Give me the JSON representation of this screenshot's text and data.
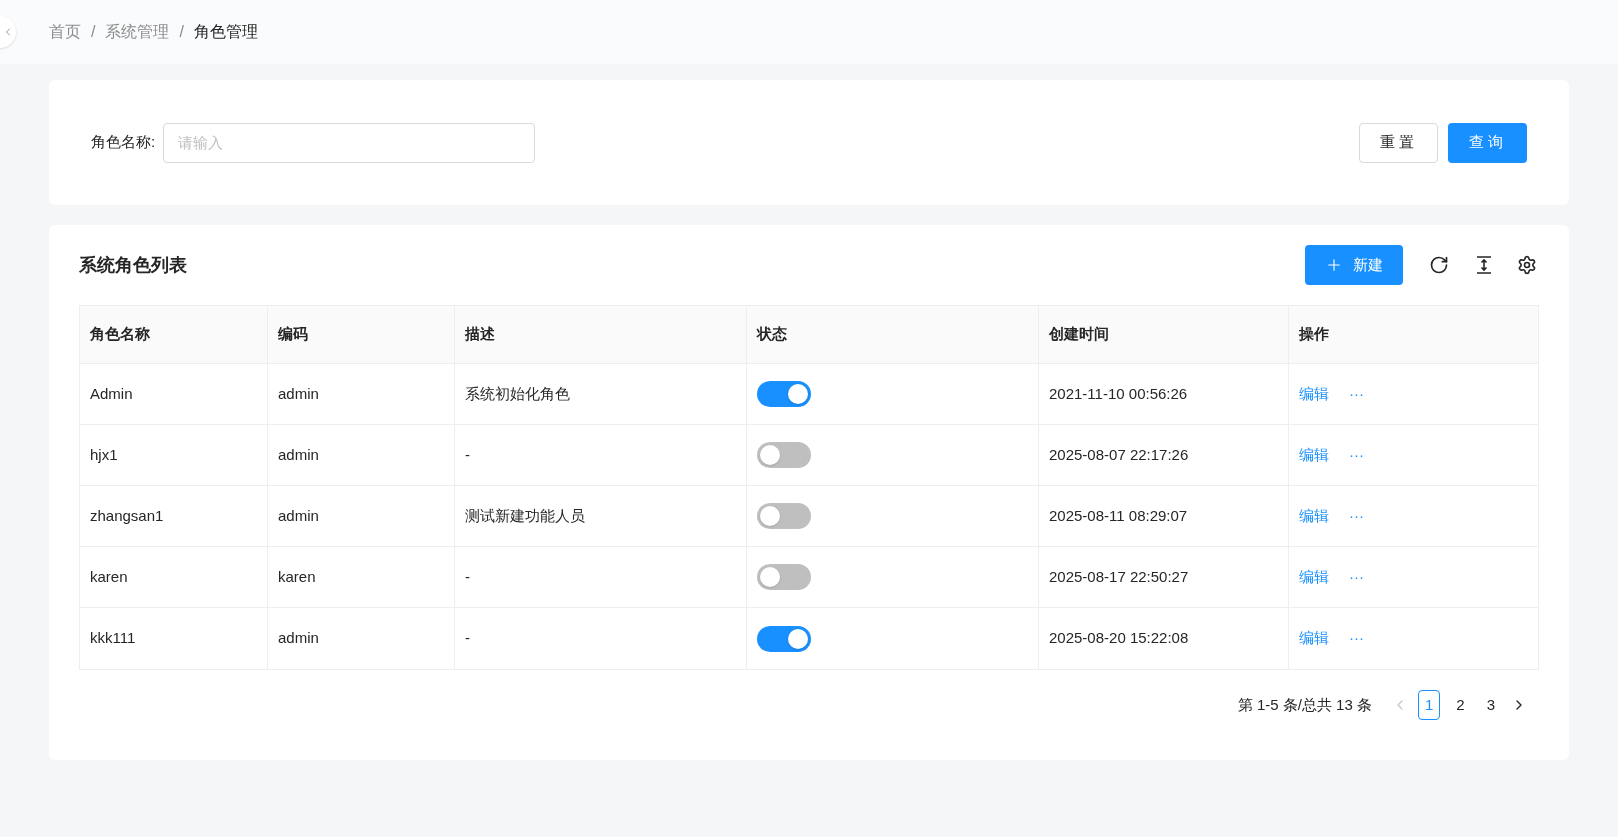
{
  "breadcrumb_separator": "/",
  "breadcrumb": [
    {
      "label": "首页",
      "current": false
    },
    {
      "label": "系统管理",
      "current": false
    },
    {
      "label": "角色管理",
      "current": true
    }
  ],
  "search": {
    "label": "角色名称:",
    "placeholder": "请输入",
    "buttons": [
      {
        "label": "重置",
        "kind": "default"
      },
      {
        "label": "查询",
        "kind": "primary"
      }
    ]
  },
  "table_card": {
    "title": "系统角色列表",
    "new_button": "新建"
  },
  "table": {
    "columns": [
      "角色名称",
      "编码",
      "描述",
      "状态",
      "创建时间",
      "操作"
    ],
    "rows": [
      {
        "name": "Admin",
        "code": "admin",
        "description": "系统初始化角色",
        "on": true,
        "created": "2021-11-10 00:56:26",
        "edit": "编辑",
        "more": "···"
      },
      {
        "name": "hjx1",
        "code": "admin",
        "description": "-",
        "on": false,
        "created": "2025-08-07 22:17:26",
        "edit": "编辑",
        "more": "···"
      },
      {
        "name": "zhangsan1",
        "code": "admin",
        "description": "测试新建功能人员",
        "on": false,
        "created": "2025-08-11 08:29:07",
        "edit": "编辑",
        "more": "···"
      },
      {
        "name": "karen",
        "code": "karen",
        "description": "-",
        "on": false,
        "created": "2025-08-17 22:50:27",
        "edit": "编辑",
        "more": "···"
      },
      {
        "name": "kkk111",
        "code": "admin",
        "description": "-",
        "on": true,
        "created": "2025-08-20 15:22:08",
        "edit": "编辑",
        "more": "···"
      }
    ]
  },
  "pagination": {
    "summary": "第 1-5 条/总共 13 条",
    "prev_disabled": true,
    "pages": [
      {
        "label": "1",
        "selected": true
      },
      {
        "label": "2",
        "selected": false
      },
      {
        "label": "3",
        "selected": false
      }
    ]
  }
}
